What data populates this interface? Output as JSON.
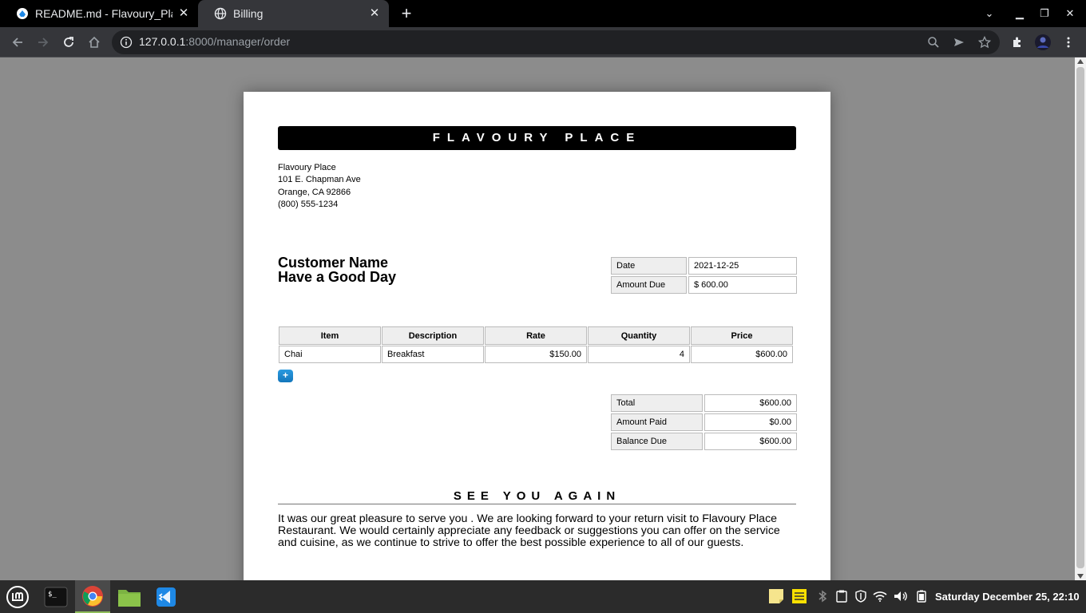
{
  "browser": {
    "tabs": [
      {
        "title": "README.md - Flavoury_Place",
        "active": false
      },
      {
        "title": "Billing",
        "active": true
      }
    ],
    "url": {
      "host": "127.0.0.1",
      "path": ":8000/manager/order"
    }
  },
  "invoice": {
    "header": "FLAVOURY PLACE",
    "address": [
      "Flavoury Place",
      "101 E. Chapman Ave",
      "Orange, CA 92866",
      "(800) 555-1234"
    ],
    "customer_name": "Customer Name",
    "customer_note": "Have a Good Day",
    "meta": {
      "date_label": "Date",
      "date_value": "2021-12-25",
      "amount_due_label": "Amount Due",
      "amount_due_value": "$  600.00"
    },
    "items_headers": [
      "Item",
      "Description",
      "Rate",
      "Quantity",
      "Price"
    ],
    "items": [
      {
        "item": "Chai",
        "description": "Breakfast",
        "rate": "$150.00",
        "quantity": "4",
        "price": "$600.00"
      }
    ],
    "add_button": "+",
    "totals": [
      {
        "label": "Total",
        "value": "$600.00"
      },
      {
        "label": "Amount Paid",
        "value": "$0.00"
      },
      {
        "label": "Balance Due",
        "value": "$600.00"
      }
    ],
    "footer_title": "SEE YOU AGAIN",
    "footer_message": "It was our great pleasure to serve you . We are looking forward to your return visit to Flavoury Place Restaurant. We would certainly appreciate any feedback or suggestions you can offer on the service and cuisine, as we continue to strive to offer the best possible experience to all of our guests."
  },
  "taskbar": {
    "clock": "Saturday December 25, 22:10"
  }
}
